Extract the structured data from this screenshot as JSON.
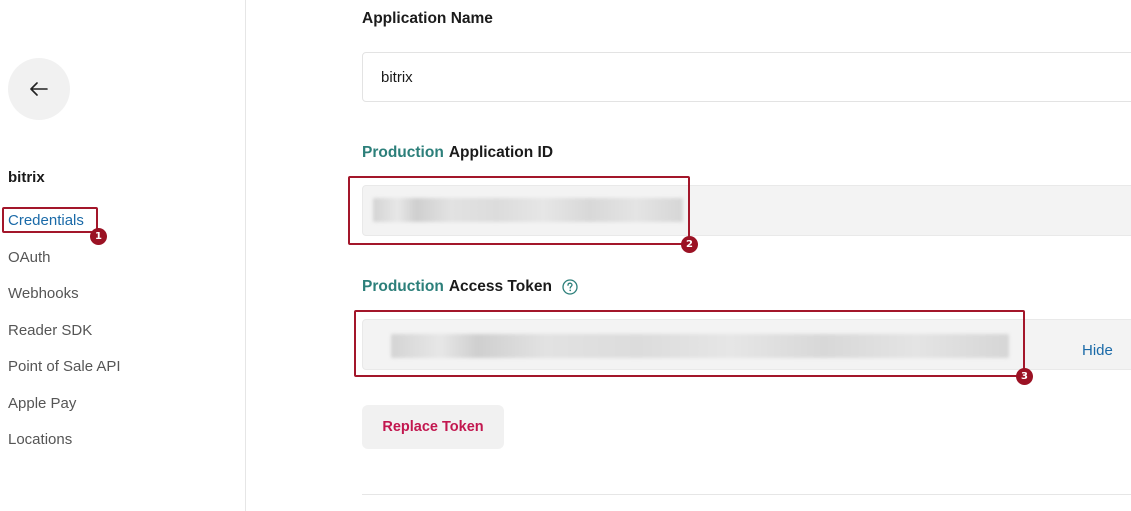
{
  "sidebar": {
    "back_icon": "arrow-left-icon",
    "app_name": "bitrix",
    "items": [
      {
        "label": "Credentials"
      },
      {
        "label": "OAuth"
      },
      {
        "label": "Webhooks"
      },
      {
        "label": "Reader SDK"
      },
      {
        "label": "Point of Sale API"
      },
      {
        "label": "Apple Pay"
      },
      {
        "label": "Locations"
      }
    ]
  },
  "main": {
    "app_name_label": "Application Name",
    "app_name_value": "bitrix",
    "app_id_env": "Production",
    "app_id_label": "Application ID",
    "token_env": "Production",
    "token_label": "Access Token",
    "help_icon": "question-circle-icon",
    "hide_label": "Hide",
    "replace_label": "Replace Token"
  },
  "annotations": [
    "1",
    "2",
    "3"
  ],
  "colors": {
    "accent_teal": "#2c7f7a",
    "link_blue": "#1a6aa8",
    "danger_pink": "#c2174f",
    "annotation_red": "#a3162a"
  }
}
